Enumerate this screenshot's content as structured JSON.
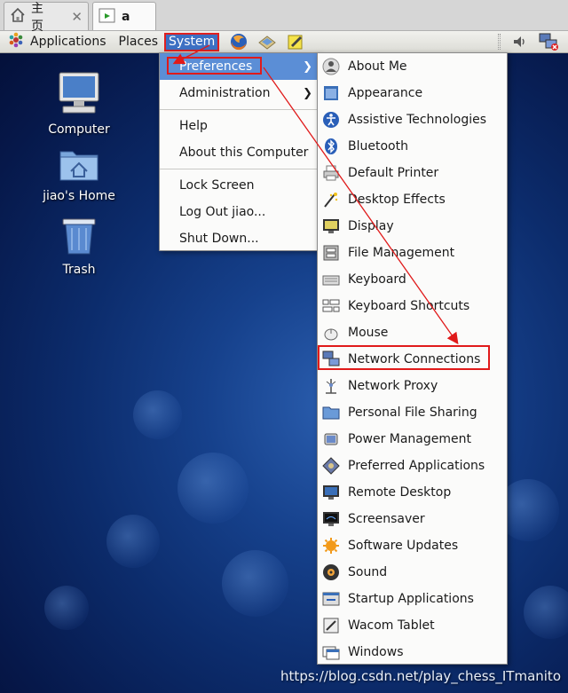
{
  "tabs": [
    {
      "label": "主页"
    },
    {
      "label": "a"
    }
  ],
  "panel": {
    "menus": {
      "applications": "Applications",
      "places": "Places",
      "system": "System"
    }
  },
  "desktop_icons": [
    {
      "label": "Computer"
    },
    {
      "label": "jiao's Home"
    },
    {
      "label": "Trash"
    }
  ],
  "system_menu": {
    "items": [
      {
        "label": "Preferences"
      },
      {
        "label": "Administration"
      },
      {
        "label": "Help"
      },
      {
        "label": "About this Computer"
      },
      {
        "label": "Lock Screen"
      },
      {
        "label": "Log Out jiao..."
      },
      {
        "label": "Shut Down..."
      }
    ]
  },
  "preferences_menu": {
    "items": [
      {
        "label": "About Me",
        "icon": "about-me-icon"
      },
      {
        "label": "Appearance",
        "icon": "appearance-icon"
      },
      {
        "label": "Assistive Technologies",
        "icon": "accessibility-icon"
      },
      {
        "label": "Bluetooth",
        "icon": "bluetooth-icon"
      },
      {
        "label": "Default Printer",
        "icon": "printer-icon"
      },
      {
        "label": "Desktop Effects",
        "icon": "desktop-effects-icon"
      },
      {
        "label": "Display",
        "icon": "display-icon"
      },
      {
        "label": "File Management",
        "icon": "file-management-icon"
      },
      {
        "label": "Keyboard",
        "icon": "keyboard-icon"
      },
      {
        "label": "Keyboard Shortcuts",
        "icon": "keyboard-shortcuts-icon"
      },
      {
        "label": "Mouse",
        "icon": "mouse-icon"
      },
      {
        "label": "Network Connections",
        "icon": "network-connections-icon"
      },
      {
        "label": "Network Proxy",
        "icon": "network-proxy-icon"
      },
      {
        "label": "Personal File Sharing",
        "icon": "file-sharing-icon"
      },
      {
        "label": "Power Management",
        "icon": "power-management-icon"
      },
      {
        "label": "Preferred Applications",
        "icon": "preferred-apps-icon"
      },
      {
        "label": "Remote Desktop",
        "icon": "remote-desktop-icon"
      },
      {
        "label": "Screensaver",
        "icon": "screensaver-icon"
      },
      {
        "label": "Software Updates",
        "icon": "software-updates-icon"
      },
      {
        "label": "Sound",
        "icon": "sound-icon"
      },
      {
        "label": "Startup Applications",
        "icon": "startup-apps-icon"
      },
      {
        "label": "Wacom Tablet",
        "icon": "wacom-tablet-icon"
      },
      {
        "label": "Windows",
        "icon": "windows-icon"
      }
    ]
  },
  "watermark": "https://blog.csdn.net/play_chess_ITmanito",
  "colors": {
    "highlight": "#5b8ed6",
    "annotation_red": "#e01a1a",
    "desktop": "#0c2c6c"
  }
}
